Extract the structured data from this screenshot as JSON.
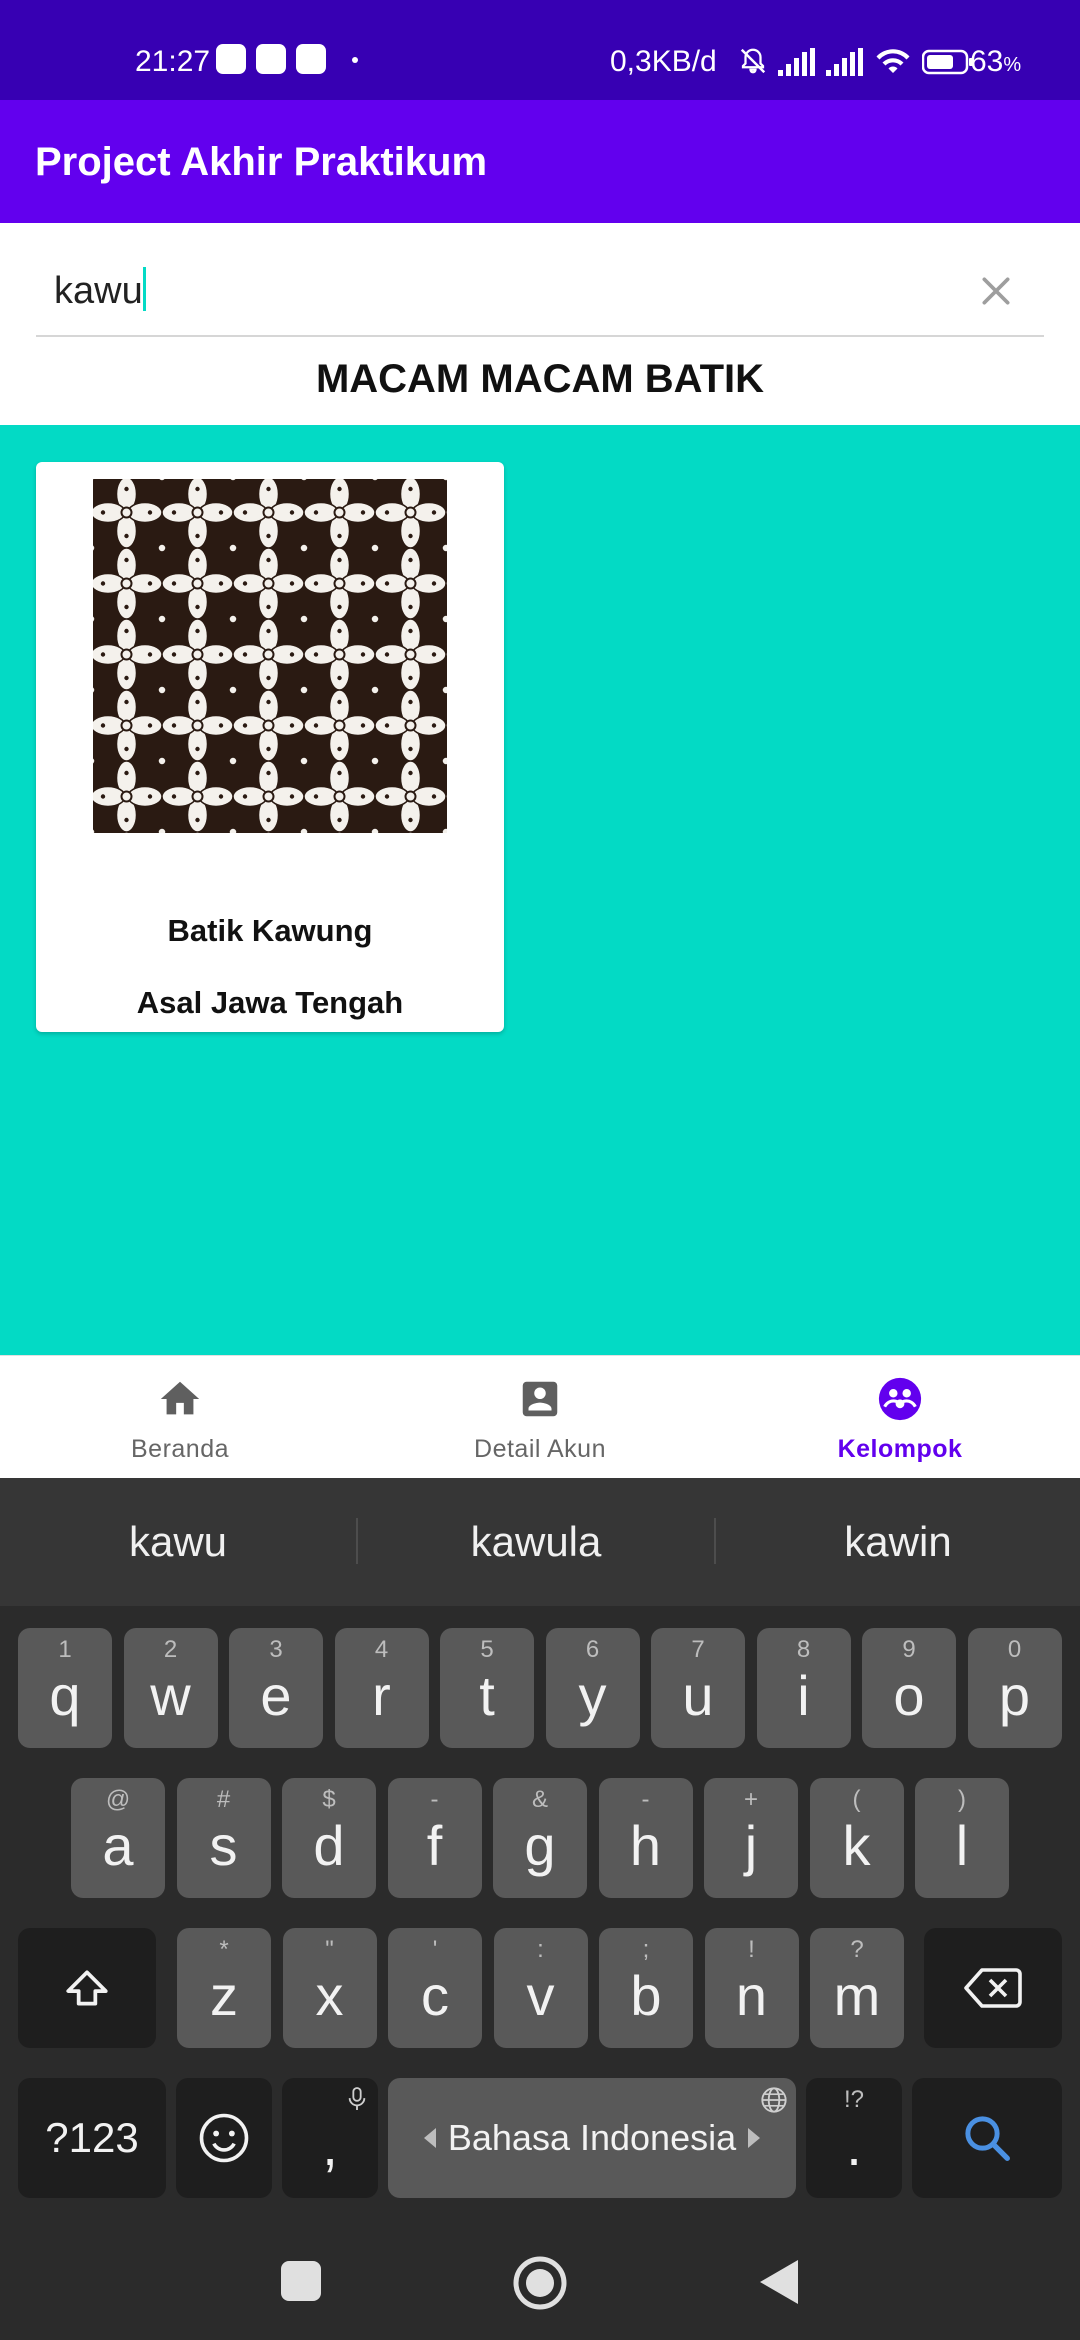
{
  "status_bar": {
    "time": "21:27",
    "network_speed": "0,3KB/d",
    "battery": "63",
    "battery_unit": "%",
    "app_icons": [
      "google-icon",
      "instagram-icon",
      "whatsapp-business-icon"
    ],
    "system_icons": [
      "mute-bell-icon",
      "signal-icon",
      "signal-icon",
      "wifi-icon",
      "battery-icon"
    ]
  },
  "app_bar": {
    "title": "Project Akhir Praktikum"
  },
  "search": {
    "value": "kawu",
    "clear_icon": "close-icon"
  },
  "section_title": "MACAM MACAM BATIK",
  "cards": [
    {
      "name": "Batik Kawung",
      "origin": "Asal Jawa Tengah",
      "image": "batik-kawung-pattern"
    }
  ],
  "bottom_nav": {
    "items": [
      {
        "label": "Beranda",
        "icon": "home-icon",
        "active": false
      },
      {
        "label": "Detail Akun",
        "icon": "account-box-icon",
        "active": false
      },
      {
        "label": "Kelompok",
        "icon": "group-icon",
        "active": true
      }
    ]
  },
  "keyboard": {
    "suggestions": [
      "kawu",
      "kawula",
      "kawin"
    ],
    "row1": [
      {
        "k": "q",
        "h": "1"
      },
      {
        "k": "w",
        "h": "2"
      },
      {
        "k": "e",
        "h": "3"
      },
      {
        "k": "r",
        "h": "4"
      },
      {
        "k": "t",
        "h": "5"
      },
      {
        "k": "y",
        "h": "6"
      },
      {
        "k": "u",
        "h": "7"
      },
      {
        "k": "i",
        "h": "8"
      },
      {
        "k": "o",
        "h": "9"
      },
      {
        "k": "p",
        "h": "0"
      }
    ],
    "row2": [
      {
        "k": "a",
        "h": "@"
      },
      {
        "k": "s",
        "h": "#"
      },
      {
        "k": "d",
        "h": "$"
      },
      {
        "k": "f",
        "h": "-"
      },
      {
        "k": "g",
        "h": "&"
      },
      {
        "k": "h",
        "h": "-"
      },
      {
        "k": "j",
        "h": "+"
      },
      {
        "k": "k",
        "h": "("
      },
      {
        "k": "l",
        "h": ")"
      }
    ],
    "row3": [
      {
        "k": "z",
        "h": "*"
      },
      {
        "k": "x",
        "h": "\""
      },
      {
        "k": "c",
        "h": "'"
      },
      {
        "k": "v",
        "h": ":"
      },
      {
        "k": "b",
        "h": ";"
      },
      {
        "k": "n",
        "h": "!"
      },
      {
        "k": "m",
        "h": "?"
      }
    ],
    "symbols_label": "?123",
    "comma": ",",
    "space_label": "Bahasa Indonesia",
    "period": ".",
    "period_hint": "!?"
  },
  "colors": {
    "status_bar": "#3700b3",
    "app_bar": "#6200ee",
    "content_bg": "#03dac5",
    "active_nav": "#6200ee",
    "search_key_icon": "#4a90e2"
  }
}
